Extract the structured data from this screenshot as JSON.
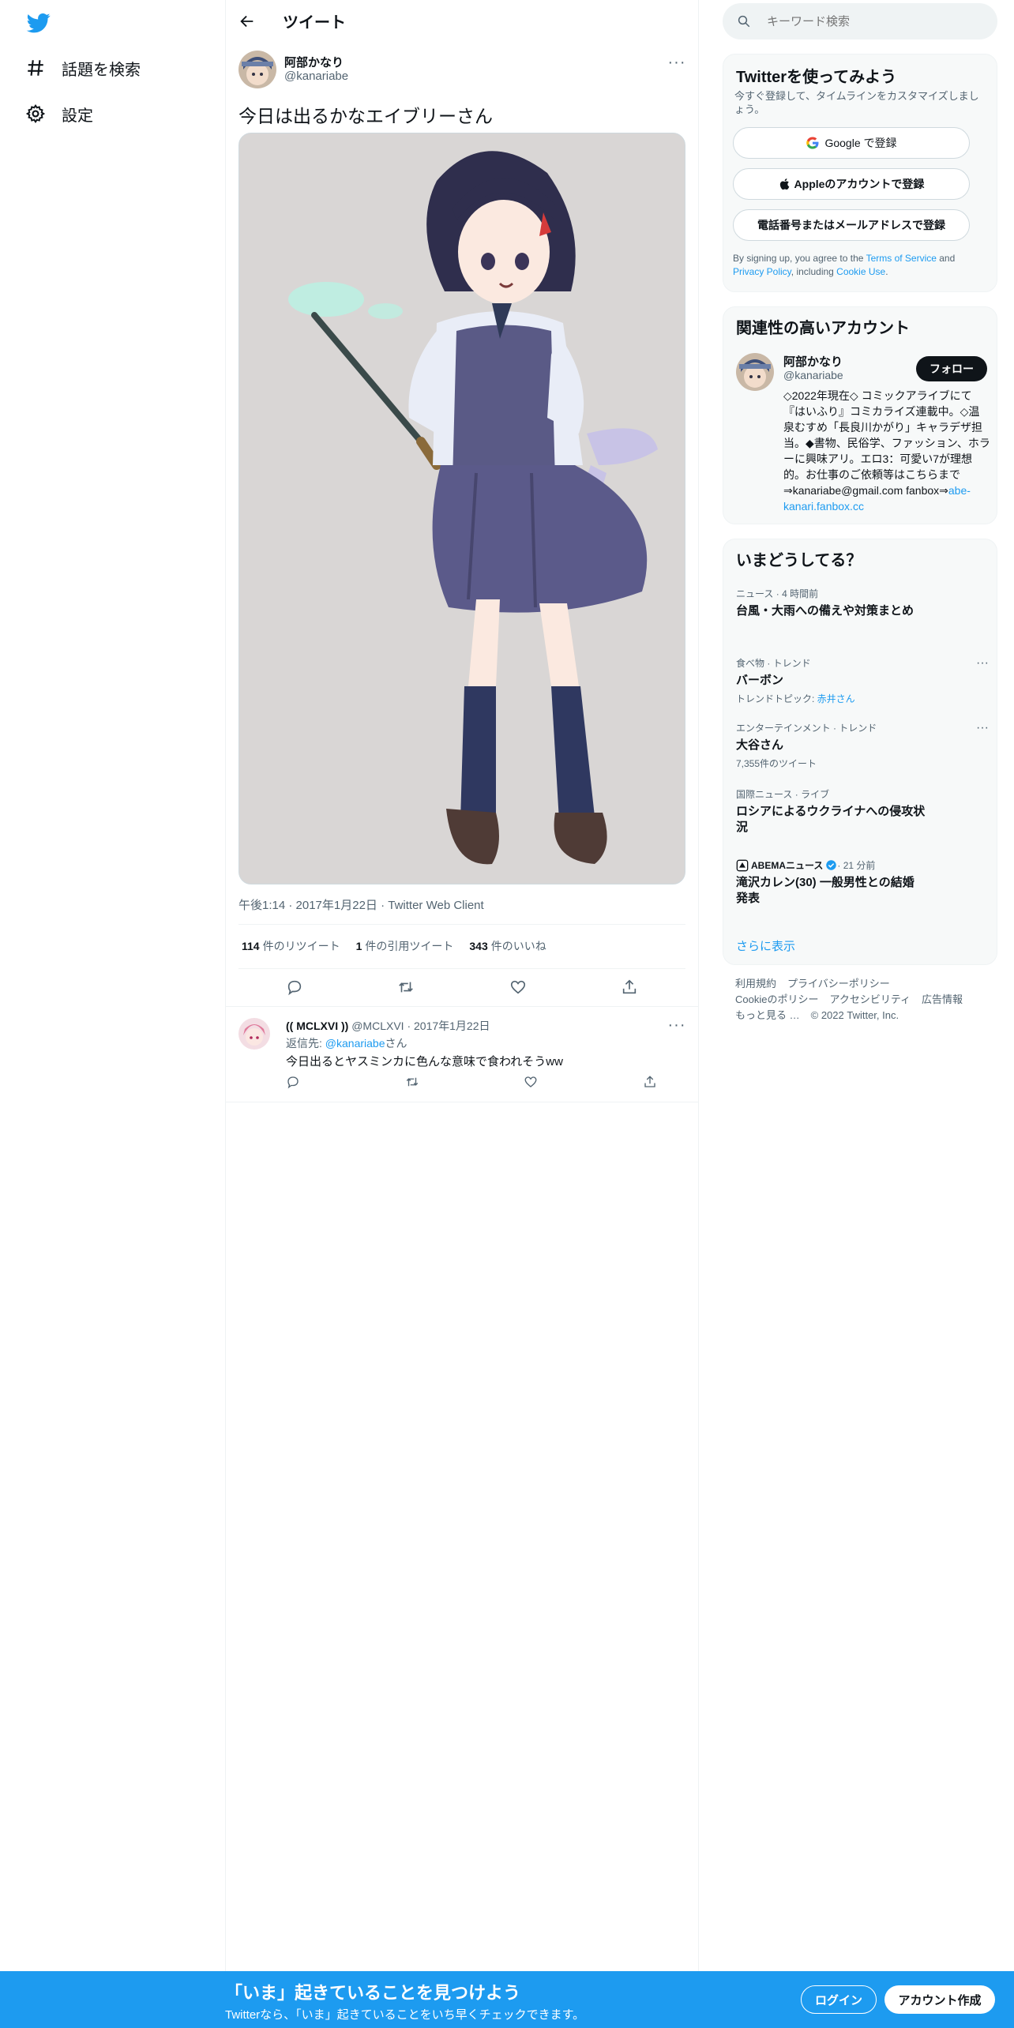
{
  "nav": {
    "logo_icon": "twitter-bird-icon",
    "items": [
      {
        "label": "話題を検索",
        "icon": "hashtag-icon"
      },
      {
        "label": "設定",
        "icon": "gear-icon"
      }
    ]
  },
  "header": {
    "title": "ツイート"
  },
  "tweet": {
    "author_name": "阿部かなり",
    "author_handle": "@kanariabe",
    "text": "今日は出るかなエイブリーさん",
    "meta": "午後1:14 · 2017年1月22日 · Twitter Web Client",
    "stats": [
      {
        "count": "114",
        "label": "件のリツイート"
      },
      {
        "count": "1",
        "label": "件の引用ツイート"
      },
      {
        "count": "343",
        "label": "件のいいね"
      }
    ]
  },
  "reply": {
    "name": "(( MCLXVI ))",
    "handle_date": "@MCLXVI · 2017年1月22日",
    "reply_to_prefix": "返信先: ",
    "reply_to_handle": "@kanariabe",
    "reply_to_suffix": "さん",
    "text": "今日出るとヤスミンカに色んな意味で食われそうww"
  },
  "search": {
    "placeholder": "キーワード検索"
  },
  "signup": {
    "title": "Twitterを使ってみよう",
    "subtitle": "今すぐ登録して、タイムラインをカスタマイズしましょう。",
    "google_label": "Google で登録",
    "apple_label": "Appleのアカウントで登録",
    "phone_label": "電話番号またはメールアドレスで登録",
    "terms_prefix": "By signing up, you agree to the ",
    "terms_link": "Terms of Service",
    "terms_and": " and ",
    "privacy_link": "Privacy Policy",
    "terms_including": ", including ",
    "cookie_link": "Cookie Use",
    "terms_end": "."
  },
  "related": {
    "title": "関連性の高いアカウント",
    "name": "阿部かなり",
    "handle": "@kanariabe",
    "follow_label": "フォロー",
    "bio": "◇2022年現在◇ コミックアライブにて『はいふり』コミカライズ連載中。◇温泉むすめ「長良川かがり」キャラデザ担当。◆書物、民俗学、ファッション、ホラーに興味アリ。エロ3：可愛い7が理想的。お仕事のご依頼等はこちらまで⇒kanariabe@gmail.com fanbox⇒",
    "bio_link": "abe-kanari.fanbox.cc"
  },
  "trends": {
    "title": "いまどうしてる？",
    "items": [
      {
        "category": "ニュース · 4 時間前",
        "title": "台風・大雨への備えや対策まとめ",
        "sub": ""
      },
      {
        "category": "食べ物 · トレンド",
        "title": "バーボン",
        "sub_prefix": "トレンドトピック: ",
        "sub_link": "赤井さん"
      },
      {
        "category": "エンターテインメント · トレンド",
        "title": "大谷さん",
        "sub": "7,355件のツイート"
      },
      {
        "category": "国際ニュース · ライブ",
        "title": "ロシアによるウクライナへの侵攻状況",
        "sub": ""
      },
      {
        "category_name": "ABEMAニュース",
        "category_time": " · 21 分前",
        "title": "滝沢カレン(30) 一般男性との結婚発表",
        "sub": ""
      }
    ],
    "show_more": "さらに表示"
  },
  "footer": {
    "links": [
      "利用規約",
      "プライバシーポリシー",
      "Cookieのポリシー",
      "アクセシビリティ",
      "広告情報",
      "もっと見る …",
      "© 2022 Twitter, Inc."
    ]
  },
  "bottom_bar": {
    "title": "「いま」起きていることを見つけよう",
    "subtitle": "Twitterなら、「いま」起きていることをいち早くチェックできます。",
    "login_label": "ログイン",
    "signup_label": "アカウント作成"
  },
  "colors": {
    "accent": "#1d9bf0",
    "text": "#0f1419",
    "muted": "#536471"
  }
}
